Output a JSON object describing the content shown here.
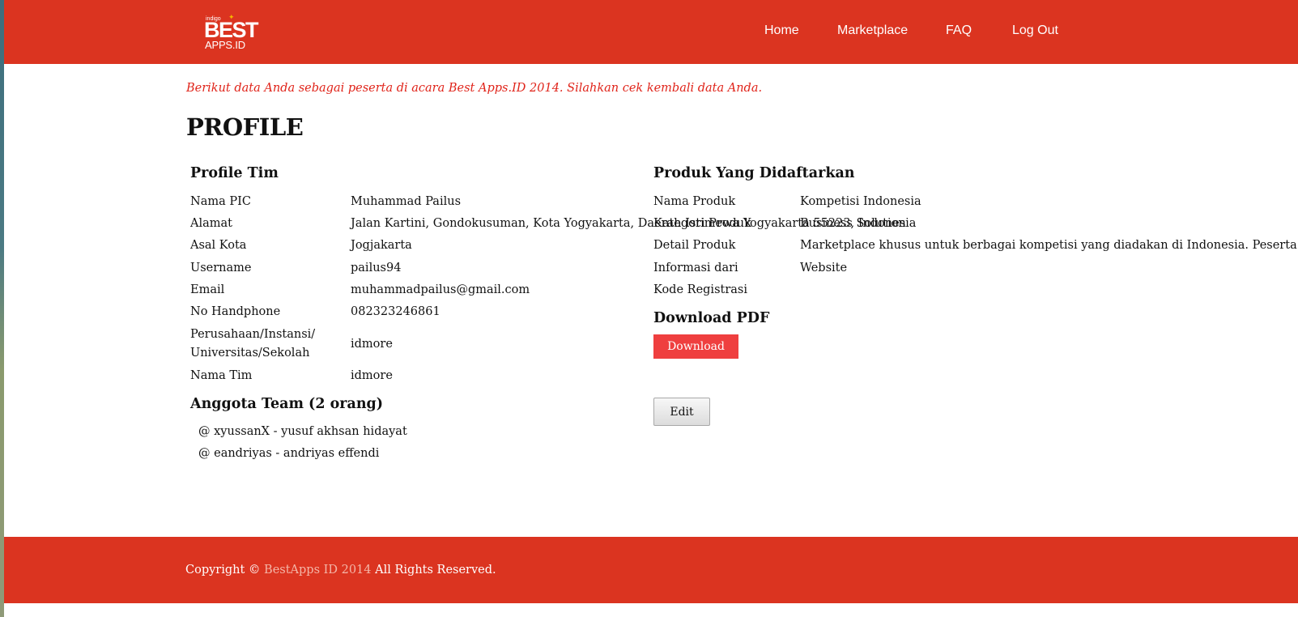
{
  "header": {
    "logo": {
      "tag": "indigo",
      "line1": "BEST",
      "line2": "APPS.ID"
    },
    "nav": [
      {
        "label": "Home"
      },
      {
        "label": "Marketplace"
      },
      {
        "label": "FAQ"
      },
      {
        "label": "Log Out"
      }
    ]
  },
  "notice": "Berikut data Anda sebagai peserta di acara Best Apps.ID 2014. Silahkan cek kembali data Anda.",
  "page_title": "PROFILE",
  "profile_tim": {
    "title": "Profile Tim",
    "rows": [
      {
        "label": "Nama PIC",
        "value": "Muhammad Pailus"
      },
      {
        "label": "Alamat",
        "value": "Jalan Kartini, Gondokusuman, Kota Yogyakarta, Daerah Istimewa Yogyakarta 55223, Indonesia"
      },
      {
        "label": "Asal Kota",
        "value": "Jogjakarta"
      },
      {
        "label": "Username",
        "value": "pailus94"
      },
      {
        "label": "Email",
        "value": "muhammadpailus@gmail.com"
      },
      {
        "label": "No Handphone",
        "value": "082323246861"
      },
      {
        "label_line1": "Perusahaan/Instansi/",
        "label_line2": "Universitas/Sekolah",
        "value": "idmore"
      },
      {
        "label": "Nama Tim",
        "value": "idmore"
      }
    ]
  },
  "anggota": {
    "title": "Anggota Team (2 orang)",
    "members": [
      "@ xyussanX - yusuf akhsan hidayat",
      "@ eandriyas - andriyas effendi"
    ]
  },
  "produk": {
    "title": "Produk Yang Didaftarkan",
    "rows": [
      {
        "label": "Nama Produk",
        "value": "Kompetisi Indonesia"
      },
      {
        "label": "Kategori Produk",
        "value": "Business Solution"
      },
      {
        "label": "Detail Produk",
        "value": "Marketplace khusus untuk berbagai kompetisi yang diadakan di Indonesia. Peserta dan p"
      },
      {
        "label": "Informasi dari",
        "value": "Website"
      },
      {
        "label": "Kode Registrasi",
        "value": ""
      }
    ]
  },
  "download": {
    "title": "Download PDF",
    "button_label": "Download"
  },
  "edit_label": "Edit",
  "footer": {
    "prefix": "Copyright © ",
    "brand": "BestApps ID 2014",
    "suffix": " All Rights Reserved."
  },
  "colors": {
    "brand_red": "#db3420",
    "notice_red": "#e0241a",
    "download_button": "#ef3f3f"
  }
}
